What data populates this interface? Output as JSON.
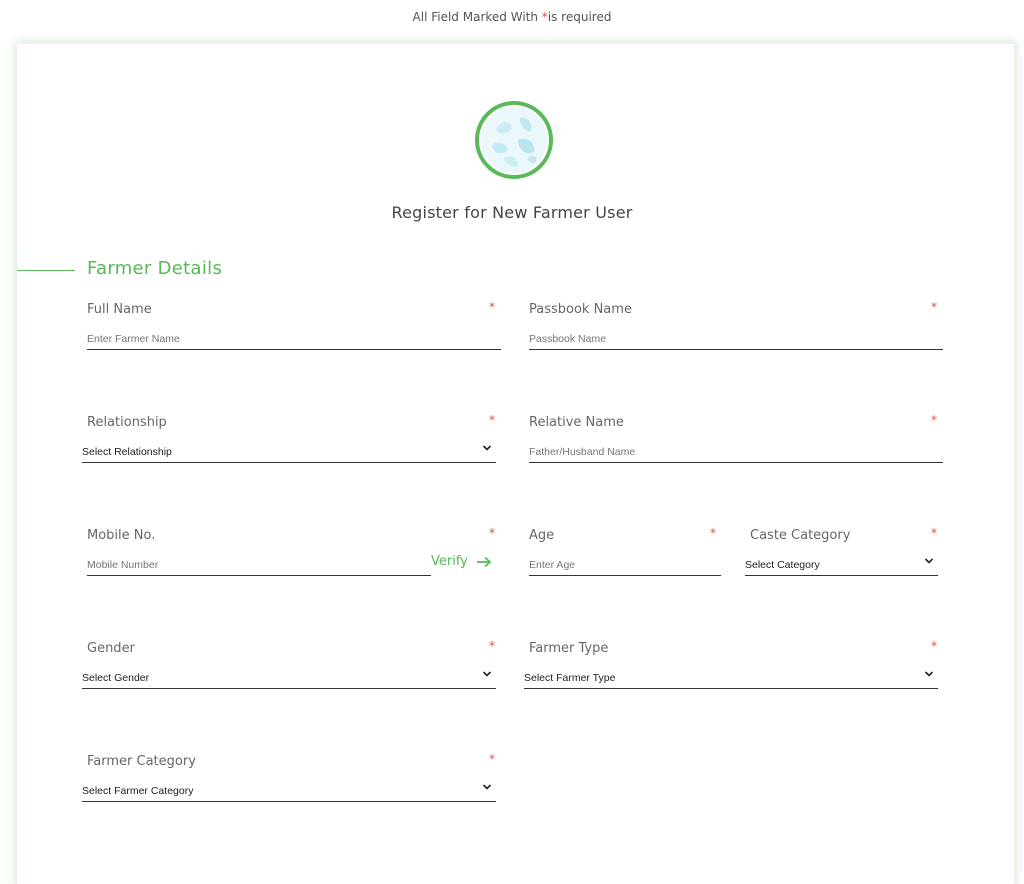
{
  "header": {
    "note_prefix": "All Field Marked With ",
    "note_star": "*",
    "note_suffix": "is required"
  },
  "page": {
    "title": "Register for New Farmer User",
    "logo_icon": "leaf-globe-icon"
  },
  "section": {
    "title": "Farmer Details",
    "accent_color": "#55b955"
  },
  "fields": {
    "full_name": {
      "label": "Full Name",
      "required": "*",
      "placeholder": "Enter Farmer Name"
    },
    "passbook_name": {
      "label": "Passbook Name",
      "required": "*",
      "placeholder": "Passbook Name"
    },
    "relationship": {
      "label": "Relationship",
      "required": "*",
      "selected": "Select Relationship"
    },
    "relative_name": {
      "label": "Relative Name",
      "required": "*",
      "placeholder": "Father/Husband Name"
    },
    "mobile": {
      "label": "Mobile No.",
      "required": "*",
      "placeholder": "Mobile Number",
      "verify_label": "Verify"
    },
    "age": {
      "label": "Age",
      "required": "*",
      "placeholder": "Enter Age"
    },
    "caste_category": {
      "label": "Caste Category",
      "required": "*",
      "selected": "Select Category"
    },
    "gender": {
      "label": "Gender",
      "required": "*",
      "selected": "Select Gender"
    },
    "farmer_type": {
      "label": "Farmer Type",
      "required": "*",
      "selected": "Select Farmer Type"
    },
    "farmer_category": {
      "label": "Farmer Category",
      "required": "*",
      "selected": "Select Farmer Category"
    }
  }
}
